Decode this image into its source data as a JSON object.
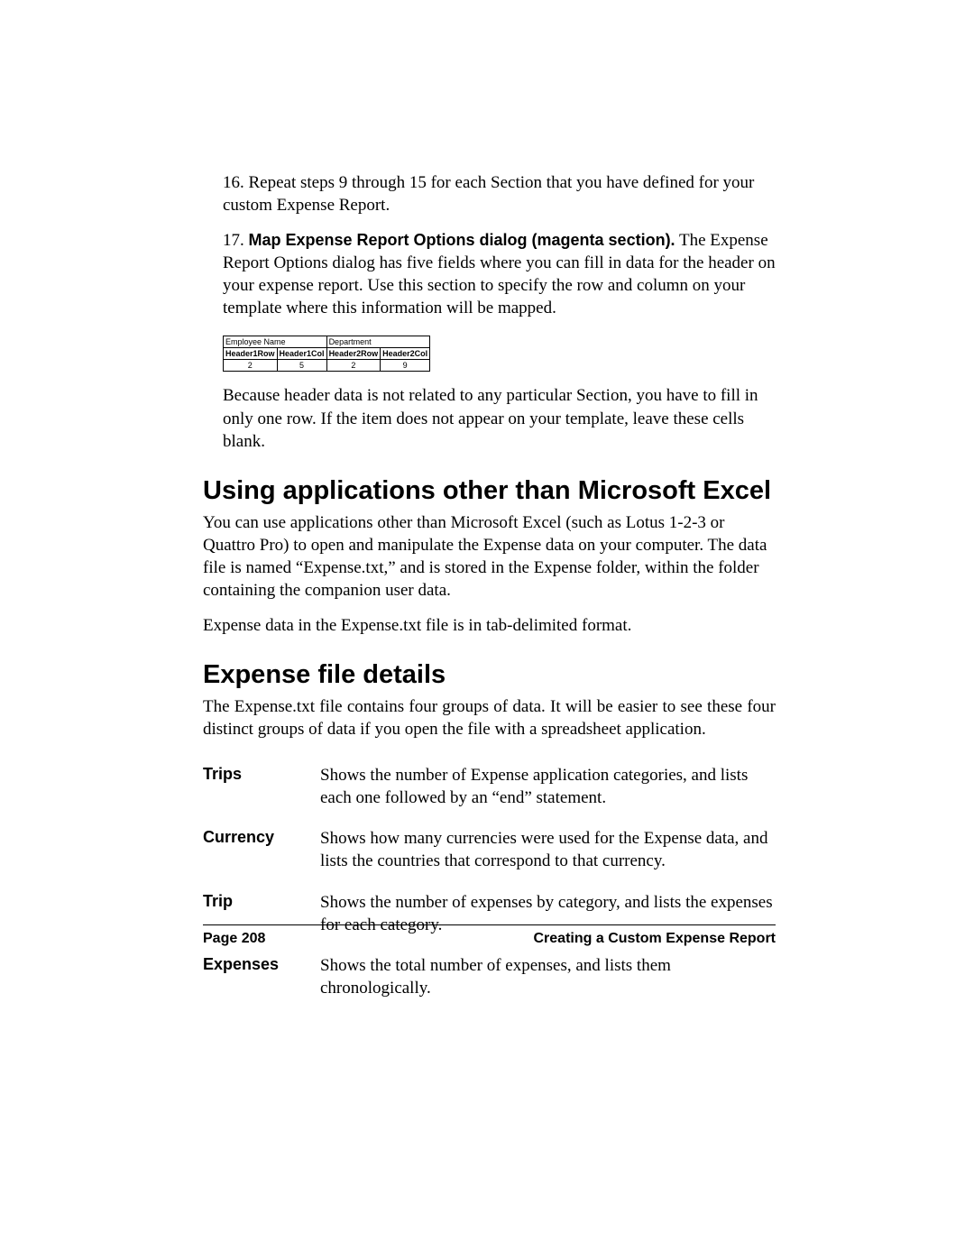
{
  "steps": {
    "s16": {
      "num": "16.",
      "text": "Repeat steps 9 through 15 for each Section that you have defined for your custom Expense Report."
    },
    "s17": {
      "num": "17.",
      "bold": "Map Expense Report Options dialog (magenta section).",
      "text": " The Expense Report Options dialog has five fields where you can fill in data for the header on your expense report. Use this section to specify the row and column on your template where this information will be mapped."
    }
  },
  "figure": {
    "top": [
      "Employee Name",
      "Department"
    ],
    "headers": [
      "Header1Row",
      "Header1Col",
      "Header2Row",
      "Header2Col"
    ],
    "values": [
      "2",
      "5",
      "2",
      "9"
    ]
  },
  "after_figure": "Because header data is not related to any particular Section, you have to fill in only one row. If the item does not appear on your template, leave these cells blank.",
  "h2a": "Using applications other than Microsoft Excel",
  "p_a1": "You can use applications other than Microsoft Excel (such as Lotus 1-2-3 or Quattro Pro) to open and manipulate the Expense data on your computer. The data file is named “Expense.txt,” and is stored in the Expense folder, within the folder containing the companion user data.",
  "p_a2": "Expense data in the Expense.txt file is in tab-delimited format.",
  "h2b": "Expense file details",
  "p_b1": "The Expense.txt file contains four groups of data. It will be easier to see these four distinct groups of data if you open the file with a spreadsheet application.",
  "defs": [
    {
      "term": "Trips",
      "desc": "Shows the number of Expense application categories, and lists each one followed by an “end” statement."
    },
    {
      "term": "Currency",
      "desc": "Shows how many currencies were used for the Expense data, and lists the countries that correspond to that currency."
    },
    {
      "term": "Trip",
      "desc": "Shows the number of expenses by category, and lists the expenses for each category."
    },
    {
      "term": "Expenses",
      "desc": "Shows the total number of expenses, and lists them chronologically."
    }
  ],
  "footer": {
    "left": "Page 208",
    "right": "Creating a Custom Expense Report"
  }
}
